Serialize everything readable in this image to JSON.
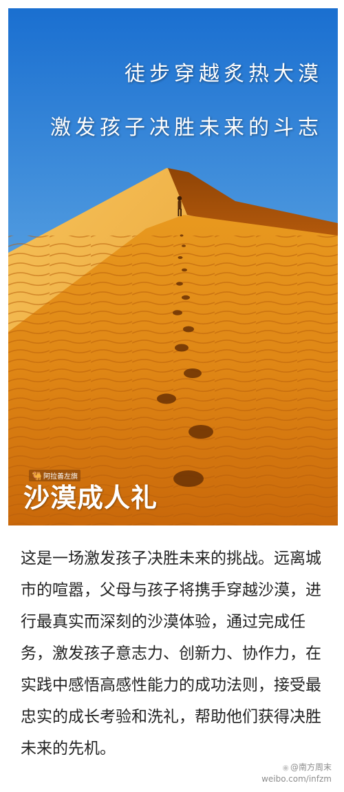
{
  "photo": {
    "headline_line1": "徒步穿越炙热大漠",
    "headline_line2": "激发孩子决胜未来的斗志",
    "brand_small": "阿拉善左旗",
    "brand_title": "沙漠成人礼",
    "camel_icon": "camel-icon",
    "colors": {
      "sky_top": "#1a6fd0",
      "sky_bottom": "#7fc3ee",
      "sand_light": "#f2b040",
      "sand_mid": "#e08a1a",
      "sand_dark": "#9a4a08"
    }
  },
  "article": {
    "body": "这是一场激发孩子决胜未来的挑战。远离城市的喧嚣，父母与孩子将携手穿越沙漠，进行最真实而深刻的沙漠体验，通过完成任务，激发孩子意志力、创新力、协作力，在实践中感悟高感性能力的成功法则，接受最忠实的成长考验和洗礼，帮助他们获得决胜未来的先机。"
  },
  "watermark": {
    "name": "@南方周末",
    "url": "weibo.com/infzm",
    "icon": "weibo-icon"
  }
}
